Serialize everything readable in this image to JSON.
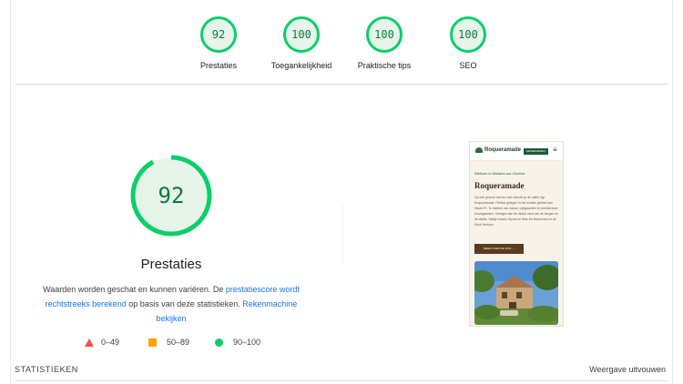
{
  "gauges": [
    {
      "score": "92",
      "label": "Prestaties"
    },
    {
      "score": "100",
      "label": "Toegankelijkheid"
    },
    {
      "score": "100",
      "label": "Praktische tips"
    },
    {
      "score": "100",
      "label": "SEO"
    }
  ],
  "main": {
    "score": "92",
    "score_fraction": 0.92,
    "title": "Prestaties",
    "desc_prefix": "Waarden worden geschat en kunnen variëren. De ",
    "desc_link1": "prestatiescore wordt rechtstreeks berekend",
    "desc_mid": " op basis van deze statistieken. ",
    "desc_link2": "Rekenmachine bekijken"
  },
  "legend": [
    {
      "range": "0–49",
      "shape": "triangle",
      "color": "#ff4e42"
    },
    {
      "range": "50–89",
      "shape": "square",
      "color": "#ffa400"
    },
    {
      "range": "90–100",
      "shape": "circle",
      "color": "#0cce6b"
    }
  ],
  "preview": {
    "logo": "Roqueramade",
    "button": "RESERVEREN",
    "breadcrumb": "Welkom in Mollans-sur-Ouvèze",
    "title": "Roqueramade",
    "body": "Op een groene heuvel, met uitzicht op de vallei, ligt Roqueramade. Perfect gelegen in het midden gebied van Haute-Pr. Te midden van natuur, wijngaarden en mediterrane boomgaarden. Gelegen aan de dichte rand van de bergen en de vlakte. Stadje tussen Nyons en Buis les Baronnies en de Mont Ventoux.",
    "cta": "MEER OVER DE SITE →"
  },
  "footer": {
    "left": "STATISTIEKEN",
    "right": "Weergave uitvouwen"
  },
  "colors": {
    "pass": "#0cce6b",
    "pass_bg": "#e6f4ea",
    "pass_text": "#0a7a3a",
    "link": "#1a73e8"
  }
}
